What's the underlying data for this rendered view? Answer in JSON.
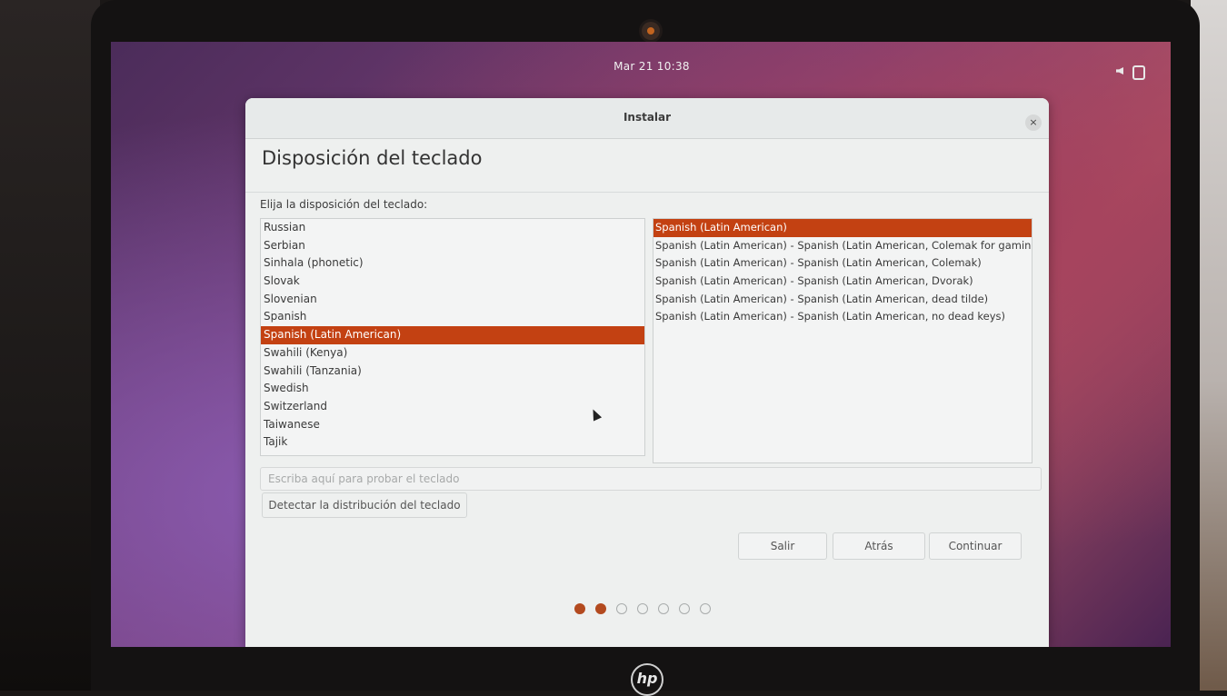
{
  "topbar": {
    "clock": "Mar 21  10:38",
    "icons": [
      "volume-icon",
      "power-icon"
    ]
  },
  "window": {
    "title": "Instalar",
    "close": "×",
    "page_title": "Disposición del teclado",
    "prompt": "Elija la disposición del teclado:"
  },
  "layouts": [
    {
      "label": "Russian",
      "selected": false
    },
    {
      "label": "Serbian",
      "selected": false
    },
    {
      "label": "Sinhala (phonetic)",
      "selected": false
    },
    {
      "label": "Slovak",
      "selected": false
    },
    {
      "label": "Slovenian",
      "selected": false
    },
    {
      "label": "Spanish",
      "selected": false
    },
    {
      "label": "Spanish (Latin American)",
      "selected": true
    },
    {
      "label": "Swahili (Kenya)",
      "selected": false
    },
    {
      "label": "Swahili (Tanzania)",
      "selected": false
    },
    {
      "label": "Swedish",
      "selected": false
    },
    {
      "label": "Switzerland",
      "selected": false
    },
    {
      "label": "Taiwanese",
      "selected": false
    },
    {
      "label": "Tajik",
      "selected": false
    }
  ],
  "variants": [
    {
      "label": "Spanish (Latin American)",
      "selected": true
    },
    {
      "label": "Spanish (Latin American) - Spanish (Latin American, Colemak for gaming)",
      "selected": false
    },
    {
      "label": "Spanish (Latin American) - Spanish (Latin American, Colemak)",
      "selected": false
    },
    {
      "label": "Spanish (Latin American) - Spanish (Latin American, Dvorak)",
      "selected": false
    },
    {
      "label": "Spanish (Latin American) - Spanish (Latin American, dead tilde)",
      "selected": false
    },
    {
      "label": "Spanish (Latin American) - Spanish (Latin American, no dead keys)",
      "selected": false
    }
  ],
  "test_input": {
    "placeholder": "Escriba aquí para probar el teclado",
    "value": ""
  },
  "detect_button": "Detectar la distribución del teclado",
  "buttons": {
    "quit": "Salir",
    "back": "Atrás",
    "continue": "Continuar"
  },
  "progress": {
    "total_steps": 7,
    "completed_steps": 2
  },
  "colors": {
    "accent": "#c34112",
    "window_bg": "#eef0ef"
  }
}
